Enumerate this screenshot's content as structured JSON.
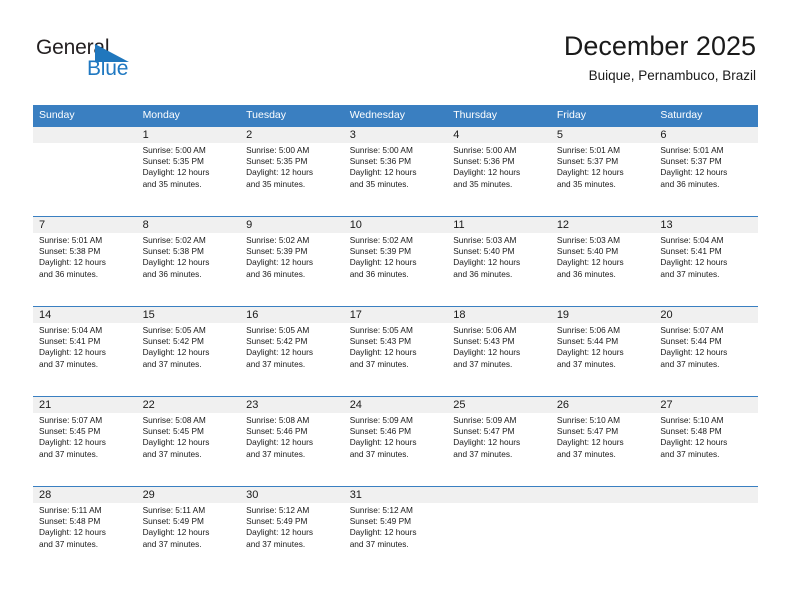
{
  "brand": {
    "name_part1": "General",
    "name_part2": "Blue",
    "triangle_icon": "triangle-icon",
    "accent_color": "#2077bd"
  },
  "header": {
    "title": "December 2025",
    "subtitle": "Buique, Pernambuco, Brazil"
  },
  "theme": {
    "header_bg": "#3a7fc1",
    "daynum_bg": "#f0f0f0",
    "text_color": "#1a1a1a"
  },
  "weekdays": [
    "Sunday",
    "Monday",
    "Tuesday",
    "Wednesday",
    "Thursday",
    "Friday",
    "Saturday"
  ],
  "weeks": [
    {
      "days": [
        {
          "num": "",
          "sunrise": "",
          "sunset": "",
          "daylight1": "",
          "daylight2": ""
        },
        {
          "num": "1",
          "sunrise": "Sunrise: 5:00 AM",
          "sunset": "Sunset: 5:35 PM",
          "daylight1": "Daylight: 12 hours",
          "daylight2": "and 35 minutes."
        },
        {
          "num": "2",
          "sunrise": "Sunrise: 5:00 AM",
          "sunset": "Sunset: 5:35 PM",
          "daylight1": "Daylight: 12 hours",
          "daylight2": "and 35 minutes."
        },
        {
          "num": "3",
          "sunrise": "Sunrise: 5:00 AM",
          "sunset": "Sunset: 5:36 PM",
          "daylight1": "Daylight: 12 hours",
          "daylight2": "and 35 minutes."
        },
        {
          "num": "4",
          "sunrise": "Sunrise: 5:00 AM",
          "sunset": "Sunset: 5:36 PM",
          "daylight1": "Daylight: 12 hours",
          "daylight2": "and 35 minutes."
        },
        {
          "num": "5",
          "sunrise": "Sunrise: 5:01 AM",
          "sunset": "Sunset: 5:37 PM",
          "daylight1": "Daylight: 12 hours",
          "daylight2": "and 35 minutes."
        },
        {
          "num": "6",
          "sunrise": "Sunrise: 5:01 AM",
          "sunset": "Sunset: 5:37 PM",
          "daylight1": "Daylight: 12 hours",
          "daylight2": "and 36 minutes."
        }
      ]
    },
    {
      "days": [
        {
          "num": "7",
          "sunrise": "Sunrise: 5:01 AM",
          "sunset": "Sunset: 5:38 PM",
          "daylight1": "Daylight: 12 hours",
          "daylight2": "and 36 minutes."
        },
        {
          "num": "8",
          "sunrise": "Sunrise: 5:02 AM",
          "sunset": "Sunset: 5:38 PM",
          "daylight1": "Daylight: 12 hours",
          "daylight2": "and 36 minutes."
        },
        {
          "num": "9",
          "sunrise": "Sunrise: 5:02 AM",
          "sunset": "Sunset: 5:39 PM",
          "daylight1": "Daylight: 12 hours",
          "daylight2": "and 36 minutes."
        },
        {
          "num": "10",
          "sunrise": "Sunrise: 5:02 AM",
          "sunset": "Sunset: 5:39 PM",
          "daylight1": "Daylight: 12 hours",
          "daylight2": "and 36 minutes."
        },
        {
          "num": "11",
          "sunrise": "Sunrise: 5:03 AM",
          "sunset": "Sunset: 5:40 PM",
          "daylight1": "Daylight: 12 hours",
          "daylight2": "and 36 minutes."
        },
        {
          "num": "12",
          "sunrise": "Sunrise: 5:03 AM",
          "sunset": "Sunset: 5:40 PM",
          "daylight1": "Daylight: 12 hours",
          "daylight2": "and 36 minutes."
        },
        {
          "num": "13",
          "sunrise": "Sunrise: 5:04 AM",
          "sunset": "Sunset: 5:41 PM",
          "daylight1": "Daylight: 12 hours",
          "daylight2": "and 37 minutes."
        }
      ]
    },
    {
      "days": [
        {
          "num": "14",
          "sunrise": "Sunrise: 5:04 AM",
          "sunset": "Sunset: 5:41 PM",
          "daylight1": "Daylight: 12 hours",
          "daylight2": "and 37 minutes."
        },
        {
          "num": "15",
          "sunrise": "Sunrise: 5:05 AM",
          "sunset": "Sunset: 5:42 PM",
          "daylight1": "Daylight: 12 hours",
          "daylight2": "and 37 minutes."
        },
        {
          "num": "16",
          "sunrise": "Sunrise: 5:05 AM",
          "sunset": "Sunset: 5:42 PM",
          "daylight1": "Daylight: 12 hours",
          "daylight2": "and 37 minutes."
        },
        {
          "num": "17",
          "sunrise": "Sunrise: 5:05 AM",
          "sunset": "Sunset: 5:43 PM",
          "daylight1": "Daylight: 12 hours",
          "daylight2": "and 37 minutes."
        },
        {
          "num": "18",
          "sunrise": "Sunrise: 5:06 AM",
          "sunset": "Sunset: 5:43 PM",
          "daylight1": "Daylight: 12 hours",
          "daylight2": "and 37 minutes."
        },
        {
          "num": "19",
          "sunrise": "Sunrise: 5:06 AM",
          "sunset": "Sunset: 5:44 PM",
          "daylight1": "Daylight: 12 hours",
          "daylight2": "and 37 minutes."
        },
        {
          "num": "20",
          "sunrise": "Sunrise: 5:07 AM",
          "sunset": "Sunset: 5:44 PM",
          "daylight1": "Daylight: 12 hours",
          "daylight2": "and 37 minutes."
        }
      ]
    },
    {
      "days": [
        {
          "num": "21",
          "sunrise": "Sunrise: 5:07 AM",
          "sunset": "Sunset: 5:45 PM",
          "daylight1": "Daylight: 12 hours",
          "daylight2": "and 37 minutes."
        },
        {
          "num": "22",
          "sunrise": "Sunrise: 5:08 AM",
          "sunset": "Sunset: 5:45 PM",
          "daylight1": "Daylight: 12 hours",
          "daylight2": "and 37 minutes."
        },
        {
          "num": "23",
          "sunrise": "Sunrise: 5:08 AM",
          "sunset": "Sunset: 5:46 PM",
          "daylight1": "Daylight: 12 hours",
          "daylight2": "and 37 minutes."
        },
        {
          "num": "24",
          "sunrise": "Sunrise: 5:09 AM",
          "sunset": "Sunset: 5:46 PM",
          "daylight1": "Daylight: 12 hours",
          "daylight2": "and 37 minutes."
        },
        {
          "num": "25",
          "sunrise": "Sunrise: 5:09 AM",
          "sunset": "Sunset: 5:47 PM",
          "daylight1": "Daylight: 12 hours",
          "daylight2": "and 37 minutes."
        },
        {
          "num": "26",
          "sunrise": "Sunrise: 5:10 AM",
          "sunset": "Sunset: 5:47 PM",
          "daylight1": "Daylight: 12 hours",
          "daylight2": "and 37 minutes."
        },
        {
          "num": "27",
          "sunrise": "Sunrise: 5:10 AM",
          "sunset": "Sunset: 5:48 PM",
          "daylight1": "Daylight: 12 hours",
          "daylight2": "and 37 minutes."
        }
      ]
    },
    {
      "days": [
        {
          "num": "28",
          "sunrise": "Sunrise: 5:11 AM",
          "sunset": "Sunset: 5:48 PM",
          "daylight1": "Daylight: 12 hours",
          "daylight2": "and 37 minutes."
        },
        {
          "num": "29",
          "sunrise": "Sunrise: 5:11 AM",
          "sunset": "Sunset: 5:49 PM",
          "daylight1": "Daylight: 12 hours",
          "daylight2": "and 37 minutes."
        },
        {
          "num": "30",
          "sunrise": "Sunrise: 5:12 AM",
          "sunset": "Sunset: 5:49 PM",
          "daylight1": "Daylight: 12 hours",
          "daylight2": "and 37 minutes."
        },
        {
          "num": "31",
          "sunrise": "Sunrise: 5:12 AM",
          "sunset": "Sunset: 5:49 PM",
          "daylight1": "Daylight: 12 hours",
          "daylight2": "and 37 minutes."
        },
        {
          "num": "",
          "sunrise": "",
          "sunset": "",
          "daylight1": "",
          "daylight2": ""
        },
        {
          "num": "",
          "sunrise": "",
          "sunset": "",
          "daylight1": "",
          "daylight2": ""
        },
        {
          "num": "",
          "sunrise": "",
          "sunset": "",
          "daylight1": "",
          "daylight2": ""
        }
      ]
    }
  ]
}
